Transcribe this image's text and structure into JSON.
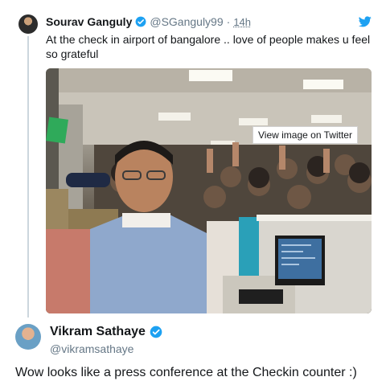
{
  "original_tweet": {
    "author_name": "Sourav Ganguly",
    "handle": "@SGanguly99",
    "separator": "·",
    "time": "14h",
    "text": "At the check in airport of bangalore .. love of people makes u feel so grateful",
    "photo_overlay": "View image on Twitter",
    "colors": {
      "verified": "#1da1f2",
      "twitter_bird": "#1da1f2",
      "thread_line": "#ccd6dd"
    },
    "icons": [
      "verified-badge-icon",
      "twitter-bird-icon"
    ]
  },
  "reply_tweet": {
    "author_name": "Vikram Sathaye",
    "handle": "@vikramsathaye",
    "text": "Wow looks like a press conference at the Checkin counter :)",
    "icons": [
      "verified-badge-icon"
    ]
  }
}
